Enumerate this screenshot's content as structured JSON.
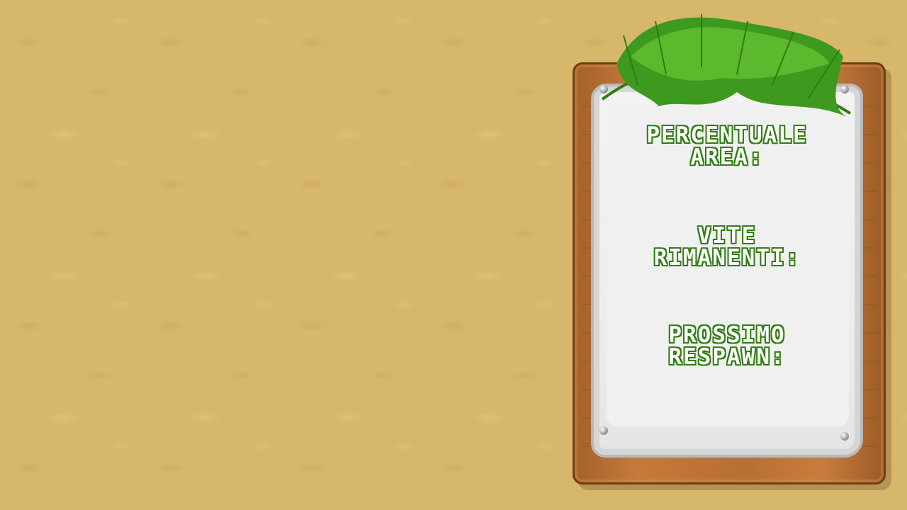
{
  "hud": {
    "area_percentage": {
      "line1": "PERCENTUALE",
      "line2": "AREA:"
    },
    "lives_remaining": {
      "line1": "VITE",
      "line2": "RIMANENTI:"
    },
    "next_respawn": {
      "line1": "PROSSIMO",
      "line2": "RESPAWN:"
    }
  },
  "icons": {
    "decoration": "palm-leaf-icon",
    "pins": "pin-icon"
  },
  "colors": {
    "background": "#d7b76b",
    "board_wood": "#c57a3b",
    "paper": "#f1f0f0",
    "text_outline": "#2f7d12",
    "leaf": "#3d9a1e"
  }
}
